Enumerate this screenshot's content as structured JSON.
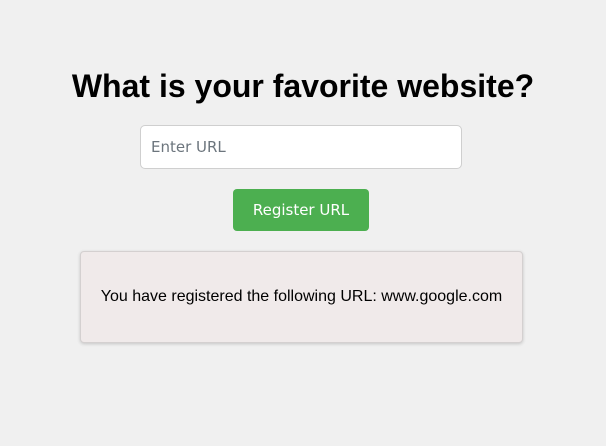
{
  "heading": "What is your favorite website?",
  "url_input": {
    "value": "",
    "placeholder": "Enter URL"
  },
  "register_button": {
    "label": "Register URL"
  },
  "result": {
    "text": "You have registered the following URL: www.google.com"
  },
  "colors": {
    "background": "#f0f0f0",
    "button": "#4caf50",
    "result_box": "#f0eaea"
  }
}
